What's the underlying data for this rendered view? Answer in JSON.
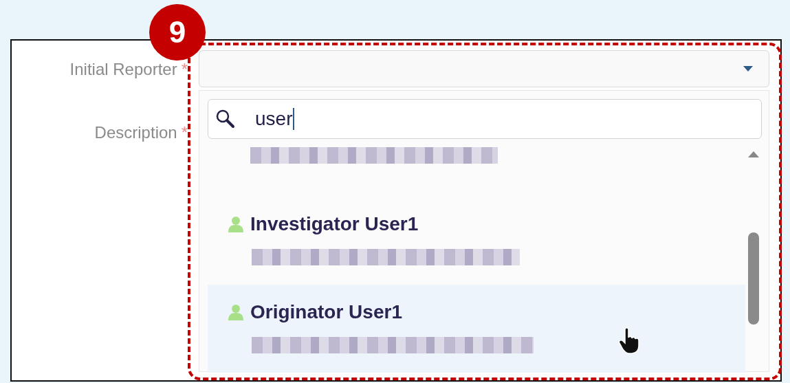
{
  "annotation": {
    "step": "9"
  },
  "form": {
    "fields": [
      {
        "label": "Initial Reporter",
        "required_mark": "*"
      },
      {
        "label": "Description",
        "required_mark": "*"
      }
    ]
  },
  "reporter_dropdown": {
    "search": {
      "value": "user"
    },
    "options": [
      {
        "highlighted": false
      },
      {
        "name": "Investigator User1",
        "highlighted": false
      },
      {
        "name": "Originator User1",
        "highlighted": true
      }
    ]
  }
}
